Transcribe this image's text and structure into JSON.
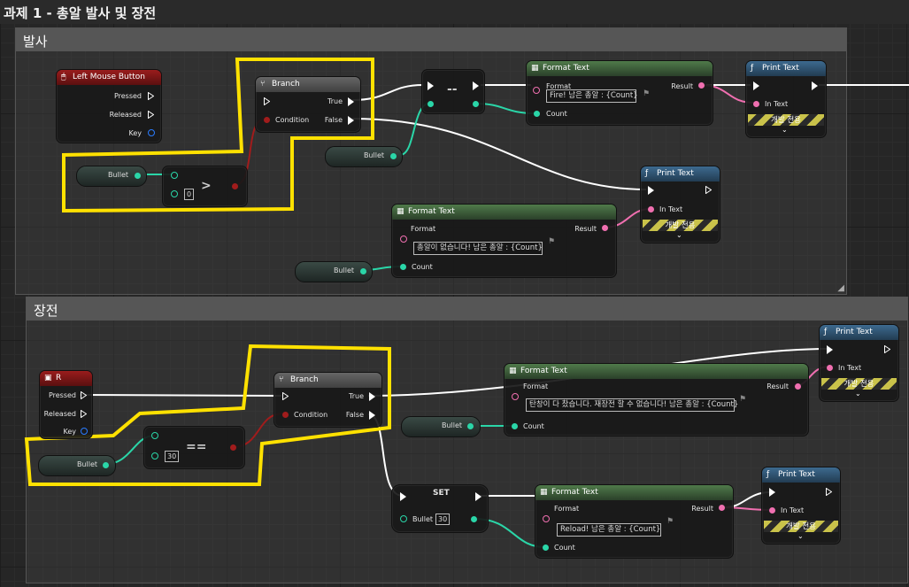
{
  "title": "과제 1 - 총알 발사 및 장전",
  "colors": {
    "exec": "#ffffff",
    "int": "#2ad6a8",
    "bool": "#a11c1c",
    "string": "#f06fb0",
    "highlight": "#ffe100"
  },
  "fire": {
    "comment": "발사",
    "lmb": {
      "title": "Left Mouse Button",
      "pressed": "Pressed",
      "released": "Released",
      "key": "Key"
    },
    "branch": {
      "title": "Branch",
      "condition": "Condition",
      "true": "True",
      "false": "False"
    },
    "var_bullet": "Bullet",
    "compare": {
      "op": ">",
      "value": "0"
    },
    "neq": {
      "op": "--"
    },
    "format1": {
      "title": "Format Text",
      "format": "Format",
      "result": "Result",
      "text": "Fire!   남은 총알 : {Count}",
      "count": "Count"
    },
    "print1": {
      "title": "Print Text",
      "in_text": "In Text",
      "dev": "개발 전용"
    },
    "print2": {
      "title": "Print Text",
      "in_text": "In Text",
      "dev": "개발 전용"
    },
    "format2": {
      "title": "Format Text",
      "format": "Format",
      "result": "Result",
      "text": "총알이 없습니다!    남은 총알 : {Count}",
      "count": "Count"
    },
    "var_bullet2": "Bullet",
    "var_bullet3": "Bullet"
  },
  "reload": {
    "comment": "장전",
    "r": {
      "title": "R",
      "pressed": "Pressed",
      "released": "Released",
      "key": "Key"
    },
    "branch": {
      "title": "Branch",
      "condition": "Condition",
      "true": "True",
      "false": "False"
    },
    "var_bullet": "Bullet",
    "equal": {
      "op": "==",
      "value": "30"
    },
    "format1": {
      "title": "Format Text",
      "format": "Format",
      "result": "Result",
      "text": "탄창이 다 찼습니다. 재장전 할 수 없습니다!   남은 총알 : {Count}",
      "count": "Count"
    },
    "var_bullet2": "Bullet",
    "print1": {
      "title": "Print Text",
      "in_text": "In Text",
      "dev": "개발 전용"
    },
    "set": {
      "title": "SET",
      "var": "Bullet",
      "value": "30"
    },
    "format2": {
      "title": "Format Text",
      "format": "Format",
      "result": "Result",
      "text": "Reload!    남은 총알 : {Count}",
      "count": "Count"
    },
    "print2": {
      "title": "Print Text",
      "in_text": "In Text",
      "dev": "개발 전용"
    }
  }
}
